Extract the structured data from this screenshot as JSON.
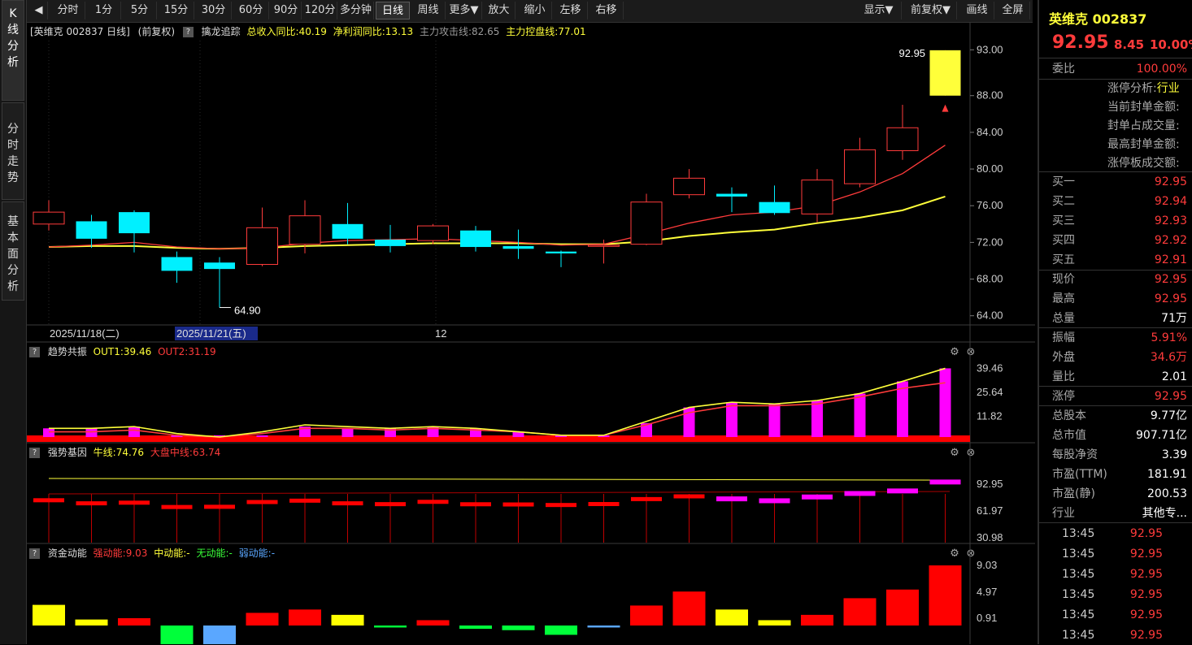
{
  "sidebar": {
    "tabs": [
      {
        "label": "K线分析",
        "chars": [
          "K",
          "线",
          "分",
          "析"
        ]
      },
      {
        "label": "分时走势",
        "chars": [
          "分",
          "时",
          "走",
          "势"
        ]
      },
      {
        "label": "基本面分析",
        "chars": [
          "基",
          "本",
          "面",
          "分",
          "析"
        ]
      }
    ]
  },
  "toolbar": {
    "items": [
      "分时",
      "1分",
      "5分",
      "15分",
      "30分",
      "60分",
      "90分",
      "120分",
      "多分钟",
      "日线",
      "周线",
      "更多▼",
      "放大",
      "缩小",
      "左移",
      "右移"
    ],
    "active": "日线",
    "right_items": [
      "显示▼",
      "前复权▼",
      "画线",
      "全屏"
    ]
  },
  "chart_info": {
    "stock": "[英维克 002837 日线]",
    "fuquan": "(前复权)",
    "indicator": "擒龙追踪",
    "revenue": "总收入同比:40.19",
    "profit": "净利润同比:13.13",
    "attack": "主力攻击线:82.65",
    "control": "主力控盘线:77.01"
  },
  "main_chart": {
    "price_ticks": [
      "93.00",
      "88.00",
      "84.00",
      "80.00",
      "76.00",
      "72.00",
      "68.00",
      "64.00"
    ],
    "high_label": "92.95",
    "low_label": "64.90",
    "dates": [
      "2025/11/18(二)",
      "2025/11/21(五)",
      "12"
    ],
    "colors": {
      "up": "#ff3b3b",
      "down": "#00f0ff",
      "ma_fast": "#ff3b3b",
      "ma_slow": "#ffff3a"
    }
  },
  "chart_data": {
    "type": "candlestick",
    "title": "英维克 002837 日线",
    "price_range": [
      63,
      94
    ],
    "candles": [
      {
        "o": 74.0,
        "c": 75.3,
        "h": 76.6,
        "l": 73.3
      },
      {
        "o": 74.3,
        "c": 72.4,
        "h": 75.0,
        "l": 71.4
      },
      {
        "o": 75.3,
        "c": 73.0,
        "h": 75.5,
        "l": 70.9
      },
      {
        "o": 70.4,
        "c": 68.9,
        "h": 71.0,
        "l": 67.6
      },
      {
        "o": 69.8,
        "c": 69.1,
        "h": 70.4,
        "l": 64.9
      },
      {
        "o": 69.6,
        "c": 73.6,
        "h": 75.8,
        "l": 69.4
      },
      {
        "o": 71.8,
        "c": 74.9,
        "h": 76.6,
        "l": 70.8
      },
      {
        "o": 74.0,
        "c": 72.4,
        "h": 76.3,
        "l": 71.8
      },
      {
        "o": 72.3,
        "c": 71.6,
        "h": 73.9,
        "l": 70.9
      },
      {
        "o": 72.2,
        "c": 73.8,
        "h": 74.0,
        "l": 71.8
      },
      {
        "o": 73.3,
        "c": 71.5,
        "h": 73.8,
        "l": 71.0
      },
      {
        "o": 71.6,
        "c": 71.3,
        "h": 73.4,
        "l": 70.2
      },
      {
        "o": 71.0,
        "c": 70.8,
        "h": 71.1,
        "l": 69.3
      },
      {
        "o": 71.6,
        "c": 71.7,
        "h": 72.3,
        "l": 69.7
      },
      {
        "o": 71.8,
        "c": 76.4,
        "h": 77.3,
        "l": 71.7
      },
      {
        "o": 77.2,
        "c": 79.0,
        "h": 80.0,
        "l": 76.8
      },
      {
        "o": 77.3,
        "c": 77.0,
        "h": 78.0,
        "l": 75.3
      },
      {
        "o": 76.4,
        "c": 75.2,
        "h": 78.2,
        "l": 75.0
      },
      {
        "o": 75.1,
        "c": 78.8,
        "h": 80.0,
        "l": 74.2
      },
      {
        "o": 78.4,
        "c": 82.1,
        "h": 83.4,
        "l": 78.0
      },
      {
        "o": 82.0,
        "c": 84.5,
        "h": 87.0,
        "l": 81.0
      },
      {
        "o": 88.0,
        "c": 92.95,
        "h": 92.95,
        "l": 88.0
      }
    ],
    "ma_fast": [
      71.5,
      71.7,
      72.0,
      71.5,
      71.3,
      71.4,
      71.9,
      72.2,
      72.3,
      72.4,
      72.2,
      72.0,
      71.7,
      71.8,
      72.9,
      74.1,
      75.0,
      75.3,
      76.0,
      77.5,
      79.5,
      82.6
    ],
    "ma_slow": [
      71.5,
      71.6,
      71.6,
      71.4,
      71.3,
      71.4,
      71.6,
      71.7,
      71.8,
      71.9,
      71.9,
      71.9,
      71.8,
      71.8,
      72.1,
      72.7,
      73.1,
      73.4,
      74.1,
      74.7,
      75.5,
      77.0
    ],
    "panels": [
      {
        "name": "趋势共振",
        "series": [
          {
            "name": "OUT1",
            "last": 39.46
          },
          {
            "name": "OUT2",
            "last": 31.19
          }
        ],
        "yticks": [
          "39.46",
          "25.64",
          "11.82"
        ],
        "bars": [
          5,
          5,
          6,
          1,
          1,
          1,
          6,
          5,
          5,
          6,
          5,
          3,
          1,
          1,
          8,
          17,
          20,
          19,
          21,
          25,
          32,
          39.46
        ],
        "line1": [
          5,
          5,
          6,
          2,
          0,
          3,
          7,
          6,
          5,
          6,
          5,
          3,
          1,
          1,
          9,
          17,
          20,
          19,
          21,
          25,
          32,
          39.46
        ],
        "line2": [
          3,
          3,
          4,
          1,
          0,
          2,
          5,
          5,
          4,
          5,
          4,
          3,
          1,
          1,
          7,
          14,
          18,
          18,
          19,
          23,
          28,
          31.19
        ]
      },
      {
        "name": "强势基因",
        "series": [
          {
            "name": "牛线",
            "last": 74.76
          },
          {
            "name": "大盘中线",
            "last": 63.74
          }
        ],
        "yticks": [
          "92.95",
          "61.97",
          "30.98"
        ]
      },
      {
        "name": "资金动能",
        "series": [
          {
            "name": "强动能",
            "last": 9.03
          },
          {
            "name": "中动能",
            "last": null
          },
          {
            "name": "无动能",
            "last": null
          },
          {
            "name": "弱动能",
            "last": null
          }
        ],
        "yticks": [
          "9.03",
          "4.97",
          "0.91"
        ],
        "bars": [
          {
            "v": 3.1,
            "c": "yellow"
          },
          {
            "v": 0.9,
            "c": "yellow"
          },
          {
            "v": 1.1,
            "c": "red"
          },
          {
            "v": -3.3,
            "c": "green"
          },
          {
            "v": -3.3,
            "c": "blue"
          },
          {
            "v": 1.9,
            "c": "red"
          },
          {
            "v": 2.4,
            "c": "red"
          },
          {
            "v": 1.6,
            "c": "yellow"
          },
          {
            "v": -0.3,
            "c": "green"
          },
          {
            "v": 0.8,
            "c": "red"
          },
          {
            "v": -0.5,
            "c": "green"
          },
          {
            "v": -0.7,
            "c": "green"
          },
          {
            "v": -1.4,
            "c": "green"
          },
          {
            "v": -0.3,
            "c": "blue"
          },
          {
            "v": 3.0,
            "c": "red"
          },
          {
            "v": 5.1,
            "c": "red"
          },
          {
            "v": 2.4,
            "c": "yellow"
          },
          {
            "v": 0.8,
            "c": "yellow"
          },
          {
            "v": 1.6,
            "c": "red"
          },
          {
            "v": 4.1,
            "c": "red"
          },
          {
            "v": 5.4,
            "c": "red"
          },
          {
            "v": 9.03,
            "c": "red"
          }
        ]
      }
    ]
  },
  "panel_labels": {
    "p1_name": "趋势共振",
    "p1_out1": "OUT1:39.46",
    "p1_out2": "OUT2:31.19",
    "p2_name": "强势基因",
    "p2_a": "牛线:74.76",
    "p2_b": "大盘中线:63.74",
    "p3_name": "资金动能",
    "p3_a": "强动能:9.03",
    "p3_b": "中动能:-",
    "p3_c": "无动能:-",
    "p3_d": "弱动能:-"
  },
  "quote": {
    "name": "英维克",
    "code": "002837",
    "price": "92.95",
    "change": "8.45",
    "pct": "10.00%",
    "weibi_label": "委比",
    "weibi_value": "100.00%",
    "limit_title": "涨停分析:",
    "limit_industry": "行业",
    "limit_lines": [
      "当前封单金额:",
      "封单占成交量:",
      "最高封单金额:",
      "涨停板成交额:"
    ],
    "bids": [
      {
        "label": "买一",
        "value": "92.95"
      },
      {
        "label": "买二",
        "value": "92.94"
      },
      {
        "label": "买三",
        "value": "92.93"
      },
      {
        "label": "买四",
        "value": "92.92"
      },
      {
        "label": "买五",
        "value": "92.91"
      }
    ],
    "stats1": [
      {
        "label": "现价",
        "value": "92.95",
        "color": "red"
      },
      {
        "label": "最高",
        "value": "92.95",
        "color": "red"
      },
      {
        "label": "总量",
        "value": "71万",
        "color": "white"
      }
    ],
    "stats2": [
      {
        "label": "振幅",
        "value": "5.91%",
        "color": "red"
      },
      {
        "label": "外盘",
        "value": "34.6万",
        "color": "red"
      },
      {
        "label": "量比",
        "value": "2.01",
        "color": "white"
      }
    ],
    "stats3": [
      {
        "label": "涨停",
        "value": "92.95",
        "color": "red"
      }
    ],
    "stats4": [
      {
        "label": "总股本",
        "value": "9.77亿"
      },
      {
        "label": "总市值",
        "value": "907.71亿"
      },
      {
        "label": "每股净资",
        "value": "3.39"
      },
      {
        "label": "市盈(TTM)",
        "value": "181.91"
      },
      {
        "label": "市盈(静)",
        "value": "200.53"
      }
    ],
    "industry_label": "行业",
    "industry_value": "其他专...",
    "ticks": [
      {
        "time": "13:45",
        "price": "92.95"
      },
      {
        "time": "13:45",
        "price": "92.95"
      },
      {
        "time": "13:45",
        "price": "92.95"
      },
      {
        "time": "13:45",
        "price": "92.95"
      },
      {
        "time": "13:45",
        "price": "92.95"
      },
      {
        "time": "13:45",
        "price": "92.95"
      }
    ]
  }
}
